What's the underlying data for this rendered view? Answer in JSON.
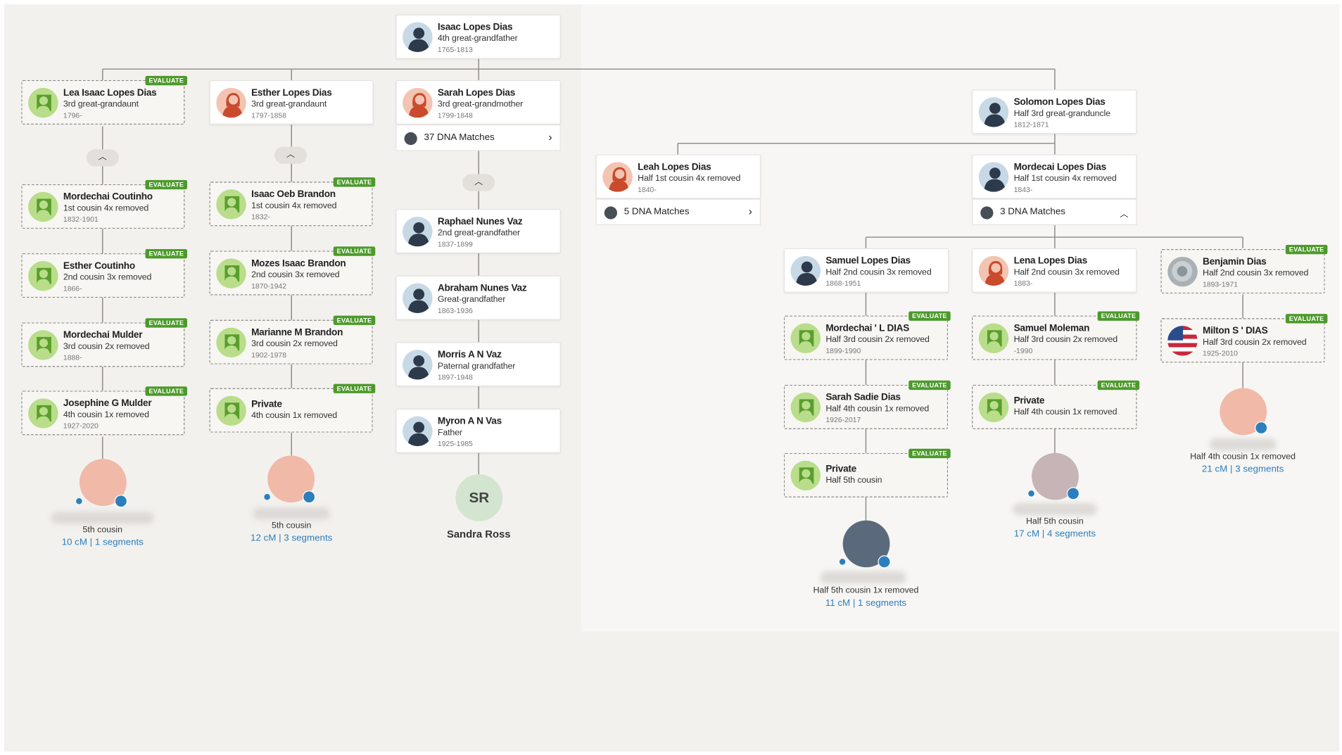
{
  "root": {
    "name": "Isaac Lopes Dias",
    "rel": "4th great-grandfather",
    "dates": "1765-1813"
  },
  "branch1": [
    {
      "name": "Lea Isaac Lopes Dias",
      "rel": "3rd great-grandaunt",
      "dates": "1796-"
    },
    {
      "name": "Mordechai Coutinho",
      "rel": "1st cousin 4x removed",
      "dates": "1832-1901"
    },
    {
      "name": "Esther Coutinho",
      "rel": "2nd cousin 3x removed",
      "dates": "1866-"
    },
    {
      "name": "Mordechai Mulder",
      "rel": "3rd cousin 2x removed",
      "dates": "1888-"
    },
    {
      "name": "Josephine G Mulder",
      "rel": "4th cousin 1x removed",
      "dates": "1927-2020"
    }
  ],
  "branch2": [
    {
      "name": "Esther Lopes Dias",
      "rel": "3rd great-grandaunt",
      "dates": "1797-1858"
    },
    {
      "name": "Isaac Oeb Brandon",
      "rel": "1st cousin 4x removed",
      "dates": "1832-"
    },
    {
      "name": "Mozes Isaac Brandon",
      "rel": "2nd cousin 3x removed",
      "dates": "1870-1942"
    },
    {
      "name": "Marianne M Brandon",
      "rel": "3rd cousin 2x removed",
      "dates": "1902-1978"
    },
    {
      "name": "Private",
      "rel": "4th cousin 1x removed",
      "dates": ""
    }
  ],
  "branch3": [
    {
      "name": "Sarah Lopes Dias",
      "rel": "3rd great-grandmother",
      "dates": "1799-1848"
    },
    {
      "name": "Raphael Nunes Vaz",
      "rel": "2nd great-grandfather",
      "dates": "1837-1899"
    },
    {
      "name": "Abraham Nunes Vaz",
      "rel": "Great-grandfather",
      "dates": "1863-1936"
    },
    {
      "name": "Morris A N Vaz",
      "rel": "Paternal grandfather",
      "dates": "1897-1948"
    },
    {
      "name": "Myron A N Vas",
      "rel": "Father",
      "dates": "1925-1985"
    }
  ],
  "solomon": {
    "name": "Solomon Lopes Dias",
    "rel": "Half 3rd great-granduncle",
    "dates": "1812-1871"
  },
  "leah": {
    "name": "Leah Lopes Dias",
    "rel": "Half 1st cousin 4x removed",
    "dates": "1840-"
  },
  "mordecai": {
    "name": "Mordecai Lopes Dias",
    "rel": "Half 1st cousin 4x removed",
    "dates": "1843-"
  },
  "samuel_branch": [
    {
      "name": "Samuel Lopes Dias",
      "rel": "Half 2nd cousin 3x removed",
      "dates": "1868-1951"
    },
    {
      "name": "Mordechai ' L DIAS",
      "rel": "Half 3rd cousin 2x removed",
      "dates": "1899-1990"
    },
    {
      "name": "Sarah Sadie Dias",
      "rel": "Half 4th cousin 1x removed",
      "dates": "1926-2017"
    },
    {
      "name": "Private",
      "rel": "Half 5th cousin",
      "dates": ""
    }
  ],
  "lena_branch": [
    {
      "name": "Lena Lopes Dias",
      "rel": "Half 2nd cousin 3x removed",
      "dates": "1883-"
    },
    {
      "name": "Samuel Moleman",
      "rel": "Half 3rd cousin 2x removed",
      "dates": "-1990"
    },
    {
      "name": "Private",
      "rel": "Half 4th cousin 1x removed",
      "dates": ""
    }
  ],
  "benjamin_branch": [
    {
      "name": "Benjamin Dias",
      "rel": "Half 2nd cousin 3x removed",
      "dates": "1893-1971"
    },
    {
      "name": "Milton S ' DIAS",
      "rel": "Half 3rd cousin 2x removed",
      "dates": "1925-2010"
    }
  ],
  "evaluate_label": "EVALUATE",
  "dna": {
    "sarah": "37 DNA Matches",
    "leah": "5 DNA Matches",
    "mordecai": "3 DNA Matches"
  },
  "matches": [
    {
      "rel": "5th cousin",
      "cm": "10 cM | 1 segments"
    },
    {
      "rel": "5th cousin",
      "cm": "12 cM | 3 segments"
    },
    {
      "rel": "Half 5th cousin 1x removed",
      "cm": "11 cM | 1 segments"
    },
    {
      "rel": "Half 5th cousin",
      "cm": "17 cM | 4 segments"
    },
    {
      "rel": "Half 4th cousin 1x removed",
      "cm": "21 cM | 3 segments"
    }
  ],
  "self": {
    "initials": "SR",
    "name": "Sandra Ross"
  },
  "icons": {
    "dna": "dna-matches-icon",
    "expand": "chevron-right-icon",
    "collapse": "chevron-up-icon"
  },
  "colors": {
    "evaluate": "#4c9a2a",
    "link": "#2b7fbd",
    "background": "#f3f1ee"
  }
}
